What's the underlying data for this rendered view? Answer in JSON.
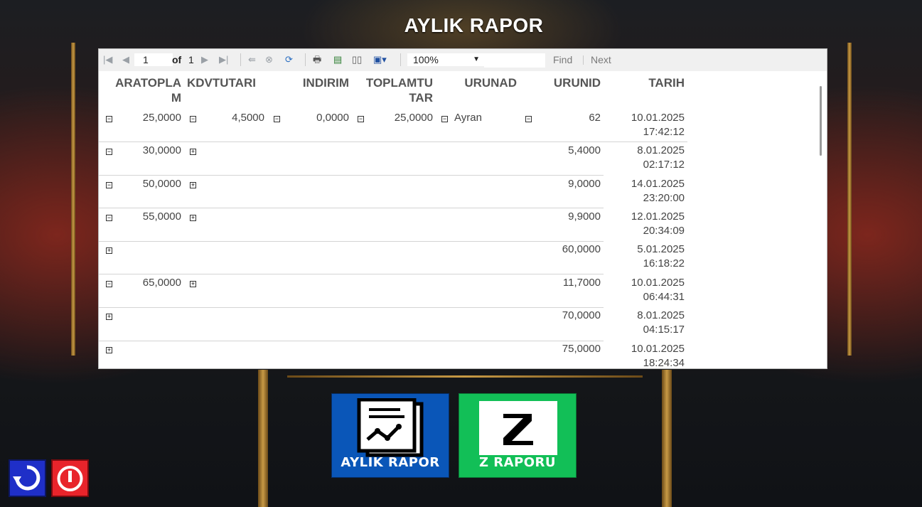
{
  "title": "AYLIK RAPOR",
  "toolbar": {
    "page_value": "1",
    "of_label": "of",
    "total_pages": "1",
    "zoom_value": "100%",
    "find_label": "Find",
    "next_label": "Next"
  },
  "columns": [
    "ARATOPLA\nM",
    "KDVTUTARI",
    "INDIRIM",
    "TOPLAMTU\nTAR",
    "URUNAD",
    "URUNID",
    "TARIH"
  ],
  "rows": [
    {
      "aratoplam": "25,0000",
      "kdv": "4,5000",
      "indirim": "0,0000",
      "toplam": "25,0000",
      "urunad": "Ayran",
      "urunid": "62",
      "tarih": "10.01.2025\n17:42:12"
    },
    {
      "aratoplam": "30,0000",
      "urunid": "5,4000",
      "tarih": "8.01.2025\n02:17:12"
    },
    {
      "aratoplam": "50,0000",
      "urunid": "9,0000",
      "tarih": "14.01.2025\n23:20:00"
    },
    {
      "aratoplam": "55,0000",
      "urunid": "9,9000",
      "tarih": "12.01.2025\n20:34:09"
    },
    {
      "urunid": "60,0000",
      "tarih": "5.01.2025\n16:18:22"
    },
    {
      "aratoplam": "65,0000",
      "urunid": "11,7000",
      "tarih": "10.01.2025\n06:44:31"
    },
    {
      "urunid": "70,0000",
      "tarih": "8.01.2025\n04:15:17"
    },
    {
      "urunid": "75,0000",
      "tarih": "10.01.2025\n18:24:34"
    }
  ],
  "buttons": {
    "aylik_rapor": "AYLIK RAPOR",
    "z_raporu": "Z RAPORU"
  },
  "colors": {
    "aylik_blue": "#0a56b8",
    "z_green": "#12bf57",
    "refresh_blue": "#1f2fc8",
    "power_red": "#e8242b"
  }
}
